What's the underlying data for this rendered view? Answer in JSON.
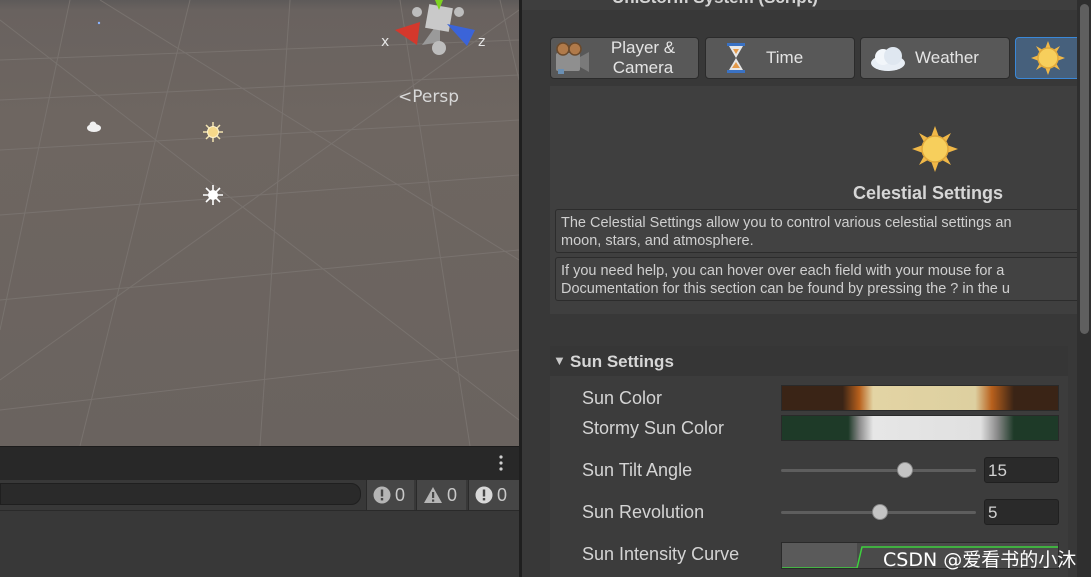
{
  "scene": {
    "gizmo": {
      "x_label": "x",
      "z_label": "z"
    },
    "persp_label": "Persp",
    "icons": [
      "cloud-icon",
      "sun-icon",
      "light-icon"
    ]
  },
  "console": {
    "error_count": "0",
    "warning_count": "0",
    "info_count": "0"
  },
  "inspector": {
    "component_title": "UniStorm System (Script)",
    "tabs": [
      {
        "label_line1": "Player &",
        "label_line2": "Camera",
        "icon": "camera-icon"
      },
      {
        "label_line1": "Time",
        "label_line2": "",
        "icon": "hourglass-icon"
      },
      {
        "label_line1": "Weather",
        "label_line2": "",
        "icon": "cloud-icon"
      },
      {
        "label_line1": "",
        "label_line2": "",
        "icon": "sun-icon"
      }
    ],
    "celestial": {
      "heading": "Celestial Settings",
      "help1_line1": "The Celestial Settings allow you to control various celestial settings an",
      "help1_line2": "moon, stars, and atmosphere.",
      "help2_line1": "If you need help, you can hover over each field with your mouse for a",
      "help2_line2": "Documentation for this section can be found by pressing the ? in the u"
    },
    "sun_settings": {
      "title": "Sun Settings",
      "sun_color_label": "Sun Color",
      "stormy_sun_color_label": "Stormy Sun Color",
      "sun_tilt_angle_label": "Sun Tilt Angle",
      "sun_tilt_angle_value": "15",
      "sun_tilt_angle_fraction": 0.65,
      "sun_revolution_label": "Sun Revolution",
      "sun_revolution_value": "5",
      "sun_revolution_fraction": 0.51,
      "sun_intensity_curve_label": "Sun Intensity Curve"
    }
  },
  "watermark": "CSDN @爱看书的小沐"
}
